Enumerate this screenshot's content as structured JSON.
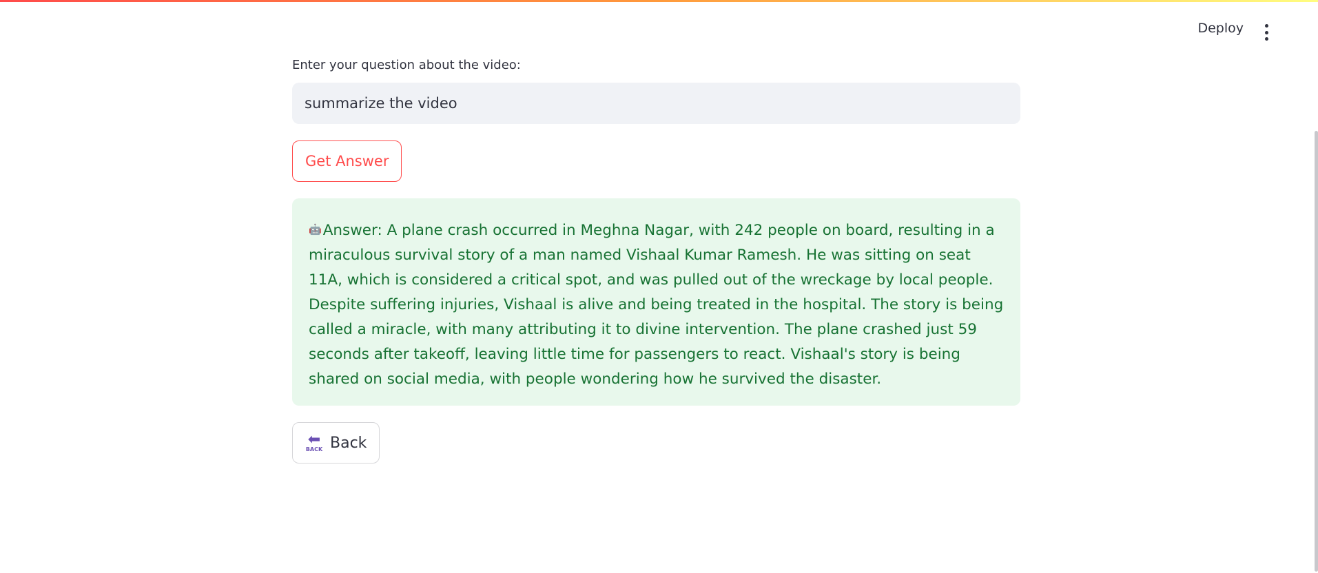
{
  "header": {
    "deploy_label": "Deploy"
  },
  "question": {
    "label": "Enter your question about the video:",
    "value": "summarize the video"
  },
  "get_answer_label": "Get Answer",
  "answer": {
    "icon": "🤖",
    "text": "Answer: A plane crash occurred in Meghna Nagar, with 242 people on board, resulting in a miraculous survival story of a man named Vishaal Kumar Ramesh. He was sitting on seat 11A, which is considered a critical spot, and was pulled out of the wreckage by local people. Despite suffering injuries, Vishaal is alive and being treated in the hospital. The story is being called a miracle, with many attributing it to divine intervention. The plane crashed just 59 seconds after takeoff, leaving little time for passengers to react. Vishaal's story is being shared on social media, with people wondering how he survived the disaster."
  },
  "back": {
    "icon_text": "BACK",
    "label": "Back"
  },
  "colors": {
    "accent": "#ff4b4b",
    "answer_bg": "#e8f8ec",
    "answer_text": "#177233",
    "back_icon": "#6a4fb3"
  }
}
